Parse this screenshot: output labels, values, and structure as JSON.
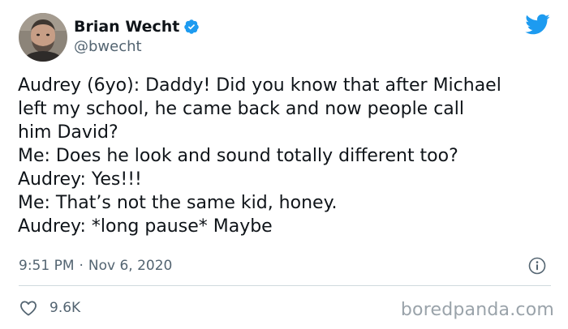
{
  "author": {
    "display_name": "Brian Wecht",
    "handle": "@bwecht",
    "verified": true
  },
  "tweet": {
    "lines": [
      "Audrey (6yo): Daddy! Did you know that after Michael",
      "left my school, he came back and now people call",
      "him David?",
      "Me: Does he look and sound totally different too?",
      "Audrey: Yes!!!",
      "Me: That’s not the same kid, honey.",
      "Audrey: *long pause* Maybe"
    ],
    "time": "9:51 PM",
    "separator": "·",
    "date": "Nov 6, 2020"
  },
  "engagement": {
    "likes": "9.6K"
  },
  "watermark": "boredpanda.com",
  "colors": {
    "twitter_blue": "#1d9bf0",
    "text": "#0f1419",
    "secondary": "#536471",
    "divider": "#cfd9de"
  },
  "icons": {
    "platform": "twitter-bird-icon",
    "verified": "verified-badge-icon",
    "info": "info-icon",
    "like": "heart-icon"
  }
}
